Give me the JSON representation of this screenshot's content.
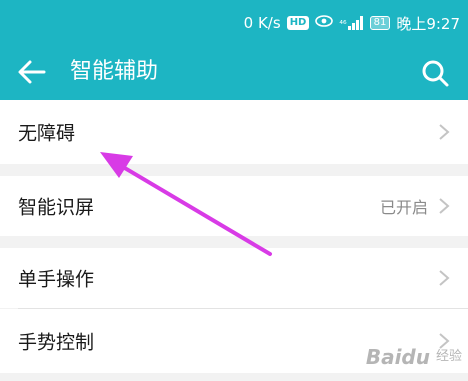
{
  "status": {
    "speed": "0 K/s",
    "hd": "HD",
    "signal": "⁴⁶",
    "battery": "81",
    "time": "晚上9:27"
  },
  "appbar": {
    "title": "智能辅助",
    "back_icon": "arrow-left-icon",
    "search_icon": "search-icon"
  },
  "items": [
    {
      "label": "无障碍",
      "value": ""
    },
    {
      "label": "智能识屏",
      "value": "已开启"
    },
    {
      "label": "单手操作",
      "value": ""
    },
    {
      "label": "手势控制",
      "value": ""
    }
  ],
  "annotation": {
    "arrow_color": "#d83be6"
  },
  "watermark": {
    "brand": "Baidu",
    "line1": "经验",
    "line2": ""
  },
  "colors": {
    "accent": "#1db5c3",
    "background": "#f2f2f2"
  }
}
